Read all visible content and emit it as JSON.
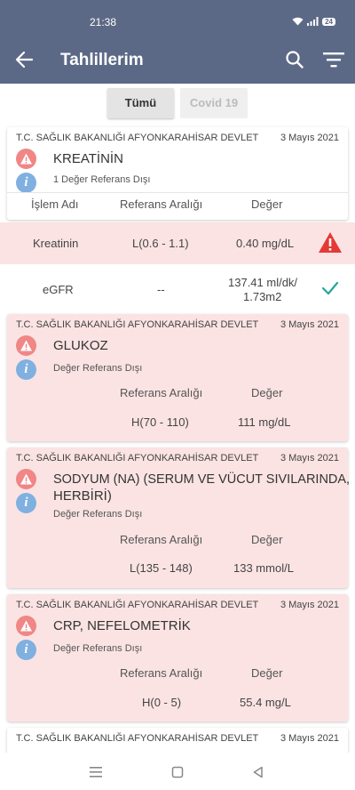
{
  "status_bar": {
    "time": "21:38",
    "battery": "24"
  },
  "app_bar": {
    "title": "Tahlillerim"
  },
  "tabs": [
    {
      "label": "Tümü",
      "active": true
    },
    {
      "label": "Covid 19",
      "active": false
    }
  ],
  "card1": {
    "hospital": "T.C. SAĞLIK BAKANLIĞI AFYONKARAHİSAR DEVLET",
    "date": "3 Mayıs 2021",
    "test_name": "KREATİNİN",
    "subtext": "1 Değer Referans Dışı",
    "headers": {
      "name": "İşlem Adı",
      "range": "Referans Aralığı",
      "value": "Değer"
    }
  },
  "rows": [
    {
      "name": "Kreatinin",
      "range": "L(0.6 - 1.1)",
      "value": "0.40 mg/dL",
      "status": "warning"
    },
    {
      "name": "eGFR",
      "range": "--",
      "value_line1": "137.41 ml/dk/",
      "value_line2": "1.73m2",
      "status": "ok"
    }
  ],
  "card2": {
    "hospital": "T.C. SAĞLIK BAKANLIĞI AFYONKARAHİSAR DEVLET",
    "date": "3 Mayıs 2021",
    "test_name": "GLUKOZ",
    "subtext": "Değer Referans Dışı",
    "range_label": "Referans Aralığı",
    "value_label": "Değer",
    "range": "H(70 - 110)",
    "value": "111 mg/dL"
  },
  "card3": {
    "hospital": "T.C. SAĞLIK BAKANLIĞI AFYONKARAHİSAR DEVLET",
    "date": "3 Mayıs 2021",
    "test_name_line1": "SODYUM (NA) (SERUM VE VÜCUT SIVILARINDA,",
    "test_name_line2": "HERBİRİ)",
    "subtext": "Değer Referans Dışı",
    "range_label": "Referans Aralığı",
    "value_label": "Değer",
    "range": "L(135 - 148)",
    "value": "133 mmol/L"
  },
  "card4": {
    "hospital": "T.C. SAĞLIK BAKANLIĞI AFYONKARAHİSAR DEVLET",
    "date": "3 Mayıs 2021",
    "test_name": "CRP, NEFELOMETRİK",
    "subtext": "Değer Referans Dışı",
    "range_label": "Referans Aralığı",
    "value_label": "Değer",
    "range": "H(0 - 5)",
    "value": "55.4 mg/L"
  },
  "card5": {
    "hospital": "T.C. SAĞLIK BAKANLIĞI AFYONKARAHİSAR DEVLET",
    "date": "3 Mayıs 2021"
  },
  "colors": {
    "primary": "#5c6986",
    "warning_bg": "#fbe3e3",
    "warning_icon": "#f08686",
    "info_icon": "#7fb0e0",
    "alert_red": "#e53935",
    "ok_green": "#26a69a"
  },
  "icons": {
    "back": "arrow-left-icon",
    "search": "search-icon",
    "filter": "filter-icon",
    "warning": "warning-icon",
    "info": "info-icon",
    "check": "check-icon"
  }
}
